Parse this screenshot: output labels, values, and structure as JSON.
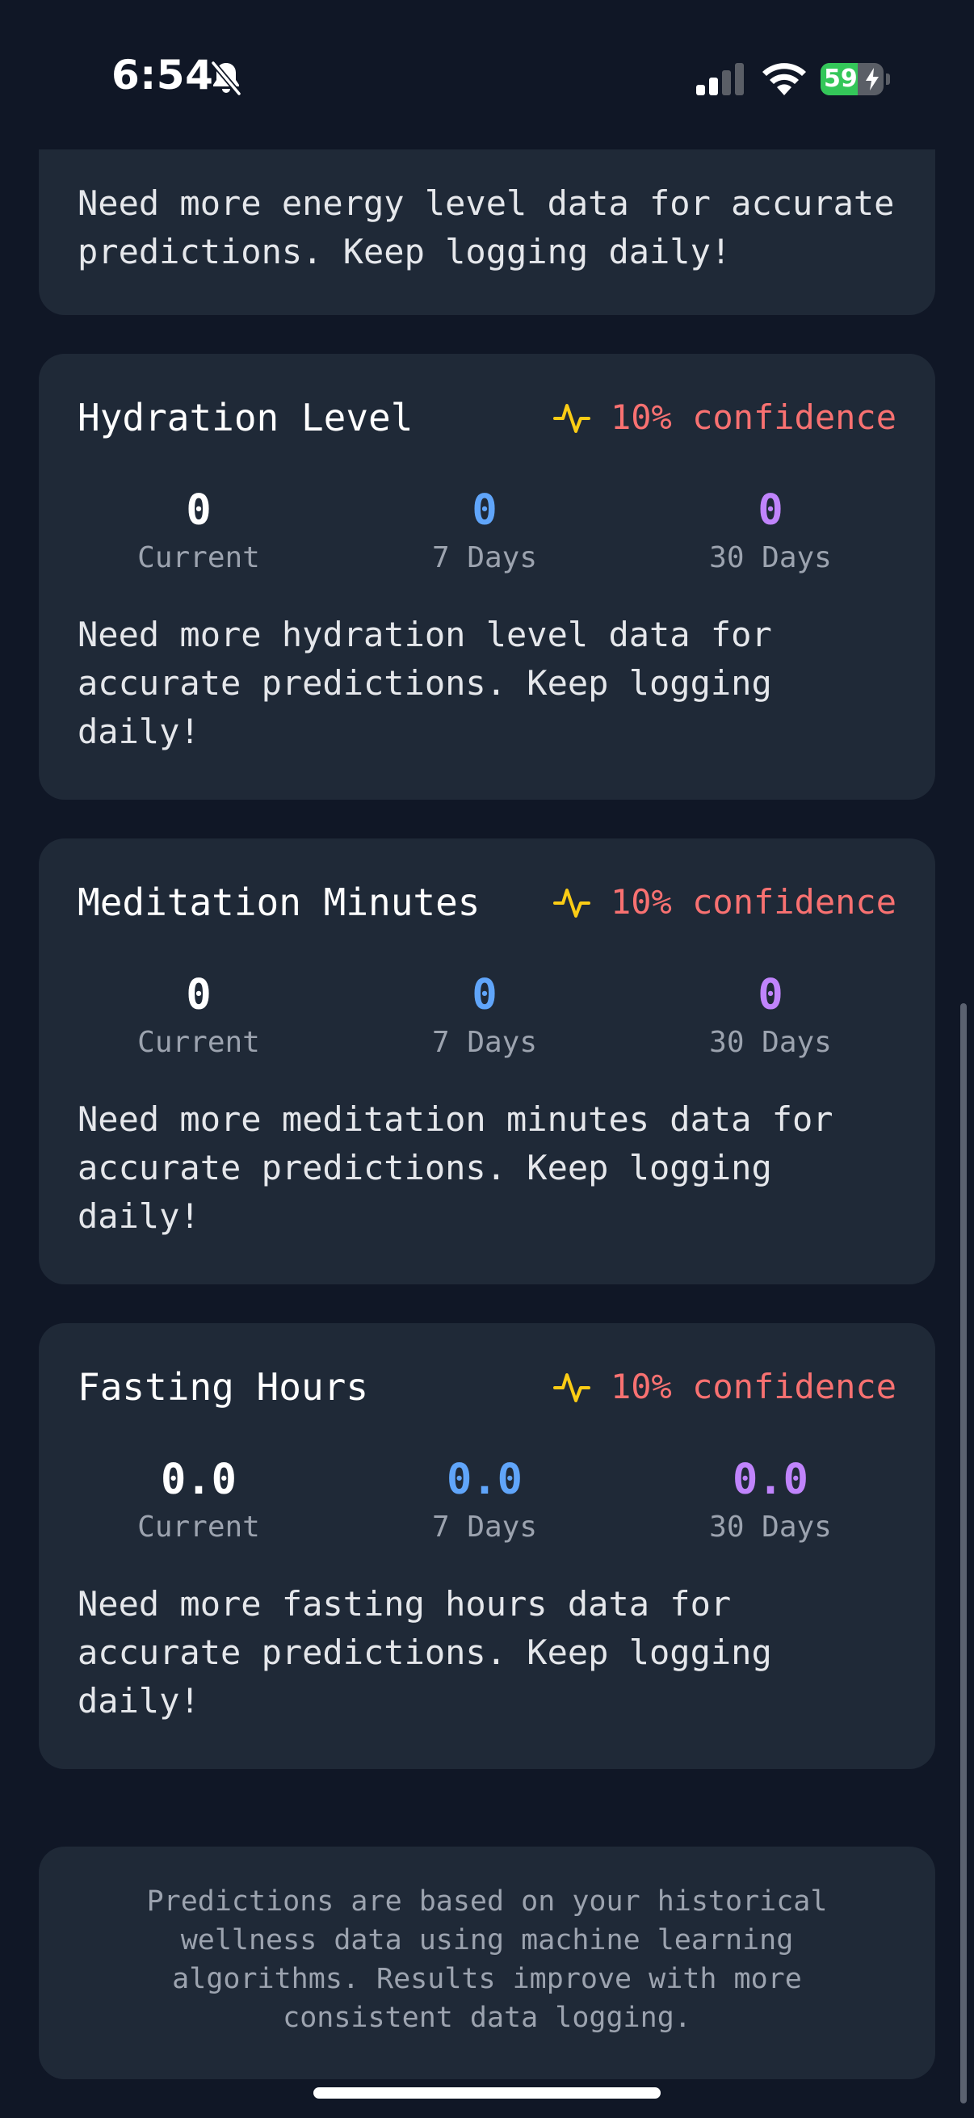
{
  "status_bar": {
    "time": "6:54",
    "battery_percent": "59",
    "battery_level": 0.59,
    "battery_color": "#34c759"
  },
  "colors": {
    "background": "#101726",
    "card": "#1f2937",
    "confidence": "#f87171",
    "pulse_icon": "#facc15",
    "seven_day": "#60a5fa",
    "thirty_day": "#c084fc"
  },
  "predictions": {
    "energy": {
      "message": "Need more energy level data for accurate predictions. Keep logging daily!"
    },
    "hydration": {
      "title": "Hydration Level",
      "confidence": "10% confidence",
      "current": "0",
      "current_label": "Current",
      "seven_day": "0",
      "seven_day_label": "7 Days",
      "thirty_day": "0",
      "thirty_day_label": "30 Days",
      "message": "Need more hydration level data for accurate predictions. Keep logging daily!"
    },
    "meditation": {
      "title": "Meditation Minutes",
      "confidence": "10% confidence",
      "current": "0",
      "current_label": "Current",
      "seven_day": "0",
      "seven_day_label": "7 Days",
      "thirty_day": "0",
      "thirty_day_label": "30 Days",
      "message": "Need more meditation minutes data for accurate predictions. Keep logging daily!"
    },
    "fasting": {
      "title": "Fasting Hours",
      "confidence": "10% confidence",
      "current": "0.0",
      "current_label": "Current",
      "seven_day": "0.0",
      "seven_day_label": "7 Days",
      "thirty_day": "0.0",
      "thirty_day_label": "30 Days",
      "message": "Need more fasting hours data for accurate predictions. Keep logging daily!"
    }
  },
  "footer": {
    "info": "Predictions are based on your historical wellness data using machine learning algorithms. Results improve with more consistent data logging."
  }
}
